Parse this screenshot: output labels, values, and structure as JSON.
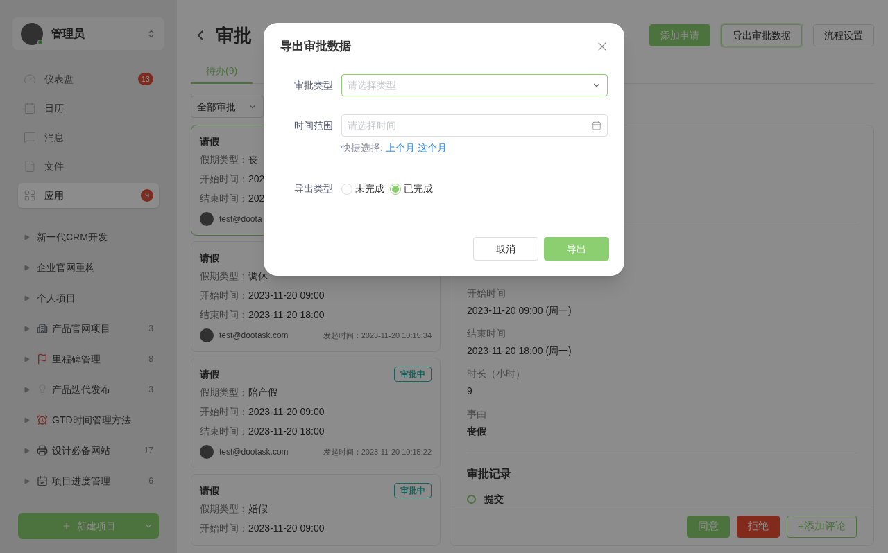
{
  "sidebar": {
    "user": {
      "name": "管理员",
      "online": true
    },
    "nav": [
      {
        "label": "仪表盘",
        "badge": "13",
        "selected": false
      },
      {
        "label": "日历",
        "selected": false
      },
      {
        "label": "消息",
        "selected": false
      },
      {
        "label": "文件",
        "selected": false
      },
      {
        "label": "应用",
        "badge": "9",
        "selected": true
      }
    ],
    "projects": [
      {
        "name": "新一代CRM开发"
      },
      {
        "name": "企业官网重构"
      },
      {
        "name": "个人项目"
      },
      {
        "name": "产品官网项目",
        "count": "3"
      },
      {
        "name": "里程碑管理",
        "count": "8"
      },
      {
        "name": "产品迭代发布",
        "count": "3"
      },
      {
        "name": "GTD时间管理方法"
      },
      {
        "name": "设计必备网站",
        "count": "17"
      },
      {
        "name": "项目进度管理",
        "count": "6"
      }
    ],
    "new_project_button": "新建项目"
  },
  "header": {
    "title": "审批",
    "buttons": [
      {
        "label": "添加申请",
        "kind": "primary"
      },
      {
        "label": "导出审批数据",
        "kind": "focused"
      },
      {
        "label": "流程设置",
        "kind": "default"
      }
    ]
  },
  "tabs": [
    {
      "label": "待办(9)",
      "selected": true
    }
  ],
  "filter": {
    "value": "全部审批"
  },
  "cards": [
    {
      "title": "请假",
      "selected": true,
      "fields": [
        {
          "label": "假期类型：",
          "value": "丧"
        },
        {
          "label": "开始时间：",
          "value": "202"
        },
        {
          "label": "结束时间：",
          "value": "202"
        }
      ],
      "user": "test@doota"
    },
    {
      "title": "请假",
      "selected": false,
      "fields": [
        {
          "label": "假期类型：",
          "value": "调休"
        },
        {
          "label": "开始时间：",
          "value": "2023-11-20 09:00"
        },
        {
          "label": "结束时间：",
          "value": "2023-11-20 18:00"
        }
      ],
      "user": "test@dootask.com",
      "submitted": "发起时间：2023-11-20 10:15:34"
    },
    {
      "title": "请假",
      "selected": false,
      "status": "审批中",
      "fields": [
        {
          "label": "假期类型：",
          "value": "陪产假"
        },
        {
          "label": "开始时间：",
          "value": "2023-11-20 09:00"
        },
        {
          "label": "结束时间：",
          "value": "2023-11-20 18:00"
        }
      ],
      "user": "test@dootask.com",
      "submitted": "发起时间：2023-11-20 10:15:22"
    },
    {
      "title": "请假",
      "selected": false,
      "status": "审批中",
      "fields": [
        {
          "label": "假期类型：",
          "value": "婚假"
        },
        {
          "label": "开始时间：",
          "value": "2023-11-20 09:00"
        }
      ]
    }
  ],
  "detail": {
    "fields": [
      {
        "label": "开始时间",
        "value": "2023-11-20 09:00 (周一)",
        "strong": false
      },
      {
        "label": "结束时间",
        "value": "2023-11-20 18:00 (周一)",
        "strong": false
      },
      {
        "label": "时长（小时）",
        "value": "9",
        "strong": false
      },
      {
        "label": "事由",
        "value": "丧假",
        "strong": true
      }
    ],
    "records_title": "审批记录",
    "records": [
      {
        "label": "提交"
      }
    ],
    "buttons": [
      {
        "label": "同意",
        "kind": "primary"
      },
      {
        "label": "拒绝",
        "kind": "danger"
      },
      {
        "label": "+添加评论",
        "kind": "outline"
      }
    ]
  },
  "dialog": {
    "title": "导出审批数据",
    "type_field": {
      "label": "审批类型",
      "placeholder": "请选择类型"
    },
    "time_field": {
      "label": "时间范围",
      "placeholder": "请选择时间"
    },
    "quick": {
      "label": "快捷选择:",
      "links": [
        "上个月",
        "这个月"
      ]
    },
    "export_type": {
      "label": "导出类型",
      "options": [
        {
          "label": "未完成",
          "selected": false
        },
        {
          "label": "已完成",
          "selected": true
        }
      ]
    },
    "buttons": [
      {
        "label": "取消",
        "kind": "default"
      },
      {
        "label": "导出",
        "kind": "primary"
      }
    ]
  }
}
